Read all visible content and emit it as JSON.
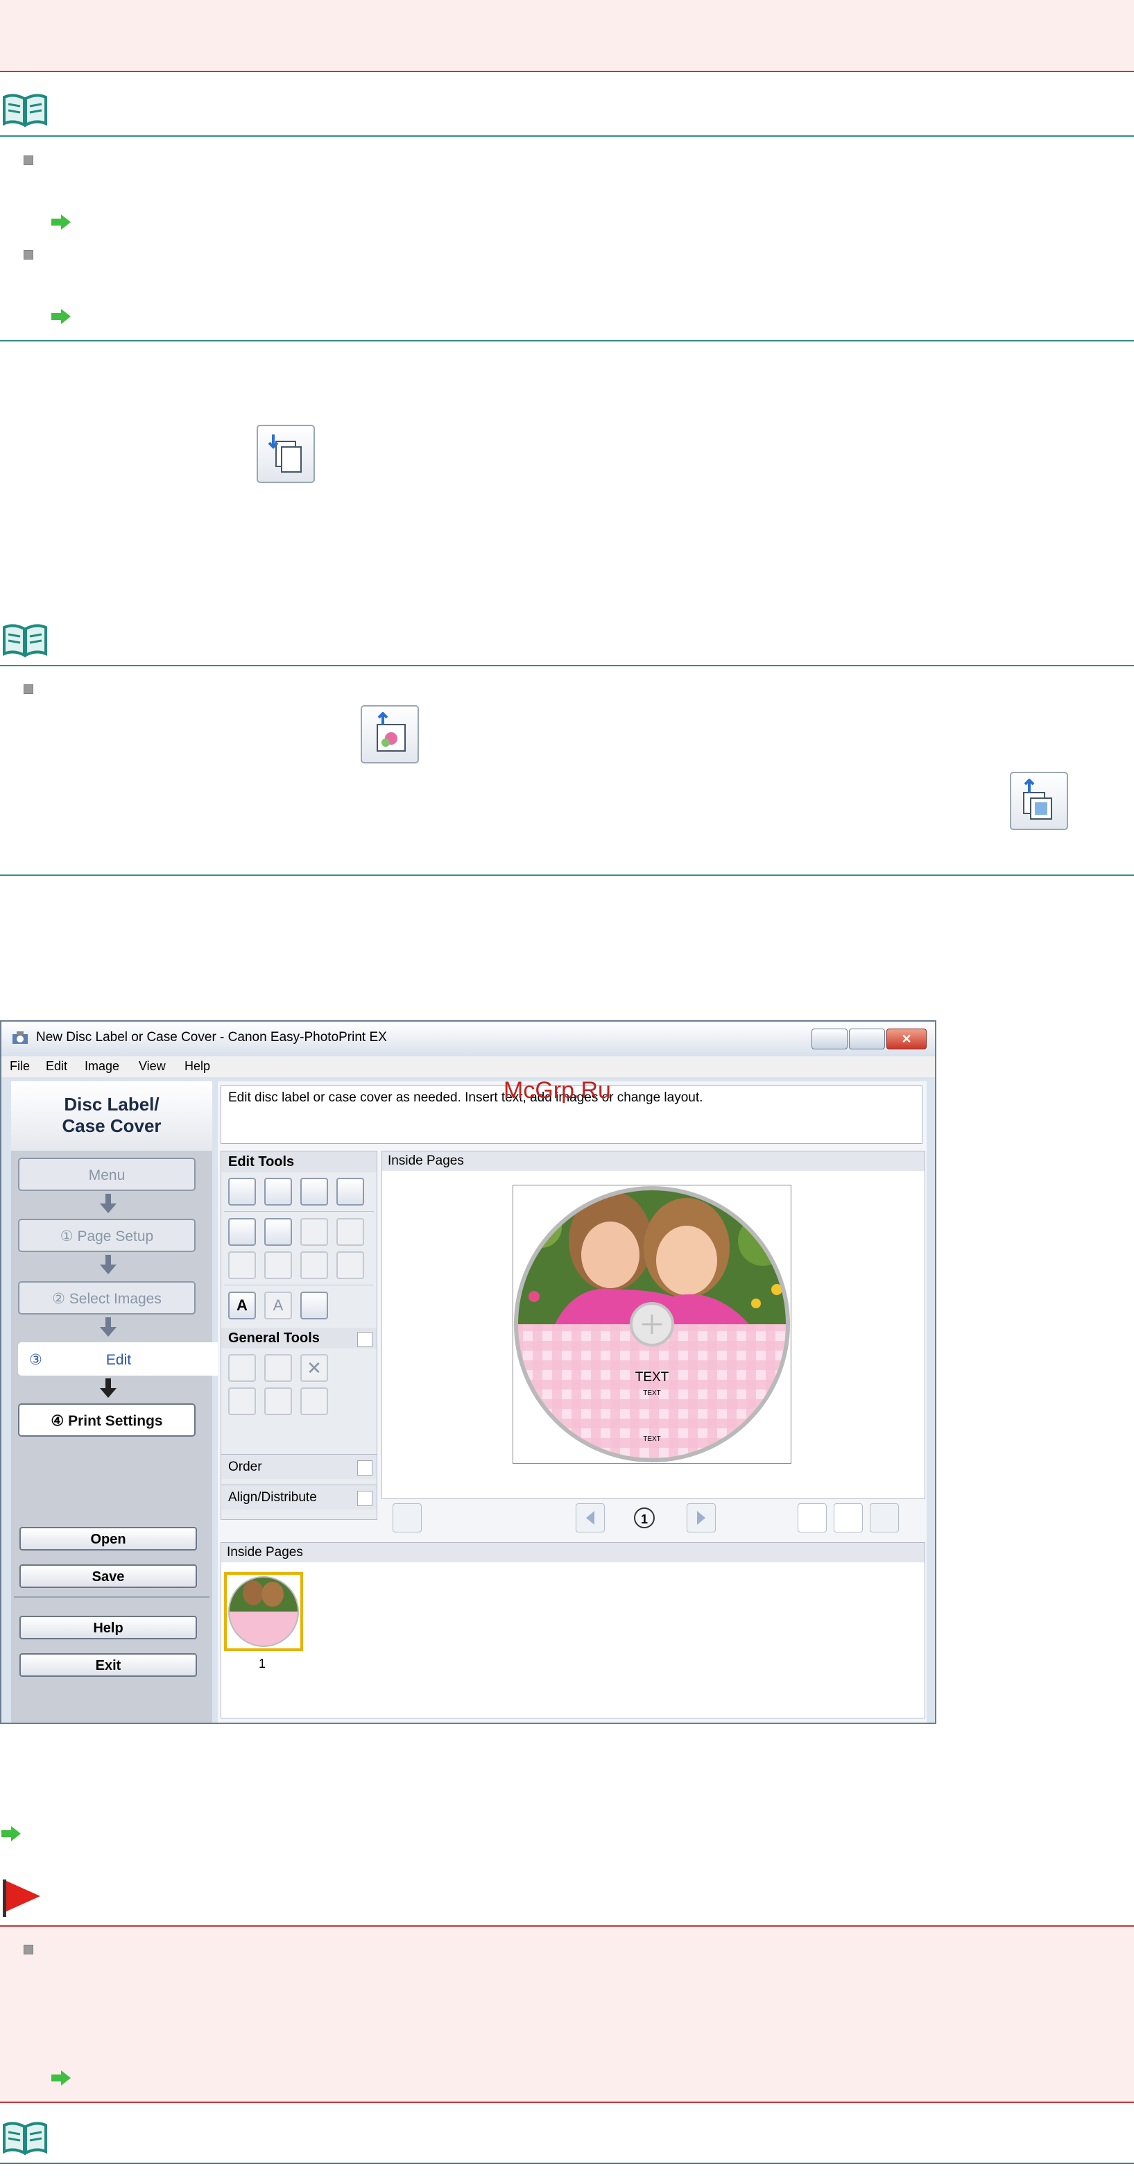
{
  "screenshot": {
    "title": "New Disc Label or Case Cover - Canon Easy-PhotoPrint EX",
    "menu": [
      "File",
      "Edit",
      "Image",
      "View",
      "Help"
    ],
    "watermark": "McGrp.Ru",
    "sidebar": {
      "header_line1": "Disc Label/",
      "header_line2": "Case Cover",
      "steps": {
        "menu": "Menu",
        "page_setup": "①  Page Setup",
        "select_images": "②  Select Images",
        "edit": "Edit",
        "edit_num": "③",
        "print_settings": "④  Print Settings"
      },
      "buttons": {
        "open": "Open",
        "save": "Save",
        "help": "Help",
        "exit": "Exit"
      }
    },
    "instruction": "Edit disc label or case cover as needed. Insert text, add images or change layout.",
    "edit_tools_label": "Edit Tools",
    "general_tools_label": "General Tools",
    "order_label": "Order",
    "align_label": "Align/Distribute",
    "canvas_header": "Inside Pages",
    "label_text_big": "TEXT",
    "label_text_small1": "TEXT",
    "label_text_small2": "TEXT",
    "page_number": "1",
    "thumbs_header": "Inside Pages",
    "thumb_number": "1"
  },
  "colors": {
    "note_rule": "#2f8f86",
    "important_rule": "#c0393b",
    "important_bg": "#fdeeee",
    "link_arrow": "#3fbf3f",
    "flag": "#e0201a"
  }
}
